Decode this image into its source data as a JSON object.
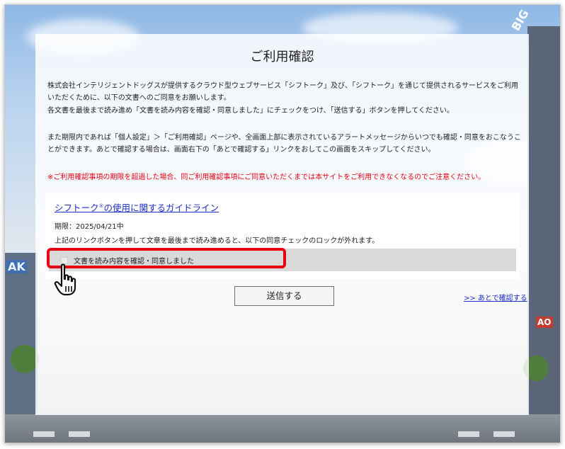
{
  "page": {
    "title": "ご利用確認",
    "intro_line1": "株式会社インテリジェントドッグスが提供するクラウド型ウェブサービス「シフトーク」及び、「シフトーク」を通じて提供されるサービスをご利用",
    "intro_line2": "いただくために、以下の文書へのご同意をお願いします。",
    "instruction": "各文書を最後まで読み進め「文書を読み内容を確認・同意しました」にチェックをつけ、「送信する」ボタンを押してください。",
    "settings_line1": "また期限内であれば「個人設定」＞「ご利用確認」ページや、全画面上部に表示されているアラートメッセージからいつでも確認・同意をおこなうこ",
    "settings_line2": "とができます。あとで確認する場合は、画面右下の「あとで確認する」リンクをおしてこの画面をスキップしてください。",
    "warning": "※ご利用確認事項の期限を超過した場合、同ご利用確認事項にご同意いただくまでは本サイトをご利用できなくなるのでご注意ください。"
  },
  "document": {
    "link_prefix": "シフトーク",
    "link_mark": "®",
    "link_suffix": "の使用に関するガイドライン",
    "deadline": "期限：2025/04/21中",
    "lock_note": "上記のリンクボタンを押して文章を最後まで読み進めると、以下の同意チェックのロックが外れます。",
    "agree_label": "文書を読み内容を確認・同意しました",
    "agree_checked": false
  },
  "actions": {
    "submit_label": "送信する",
    "later_label": ">> あとで確認する"
  },
  "background": {
    "sign_big": "BIG",
    "sign_left": "AK",
    "sign_right": "AO"
  },
  "colors": {
    "warning": "#e60012",
    "link": "#1a2ccc",
    "highlight": "#e60012"
  },
  "icons": {
    "cursor": "hand-pointer-icon",
    "checkbox": "checkbox-icon"
  }
}
